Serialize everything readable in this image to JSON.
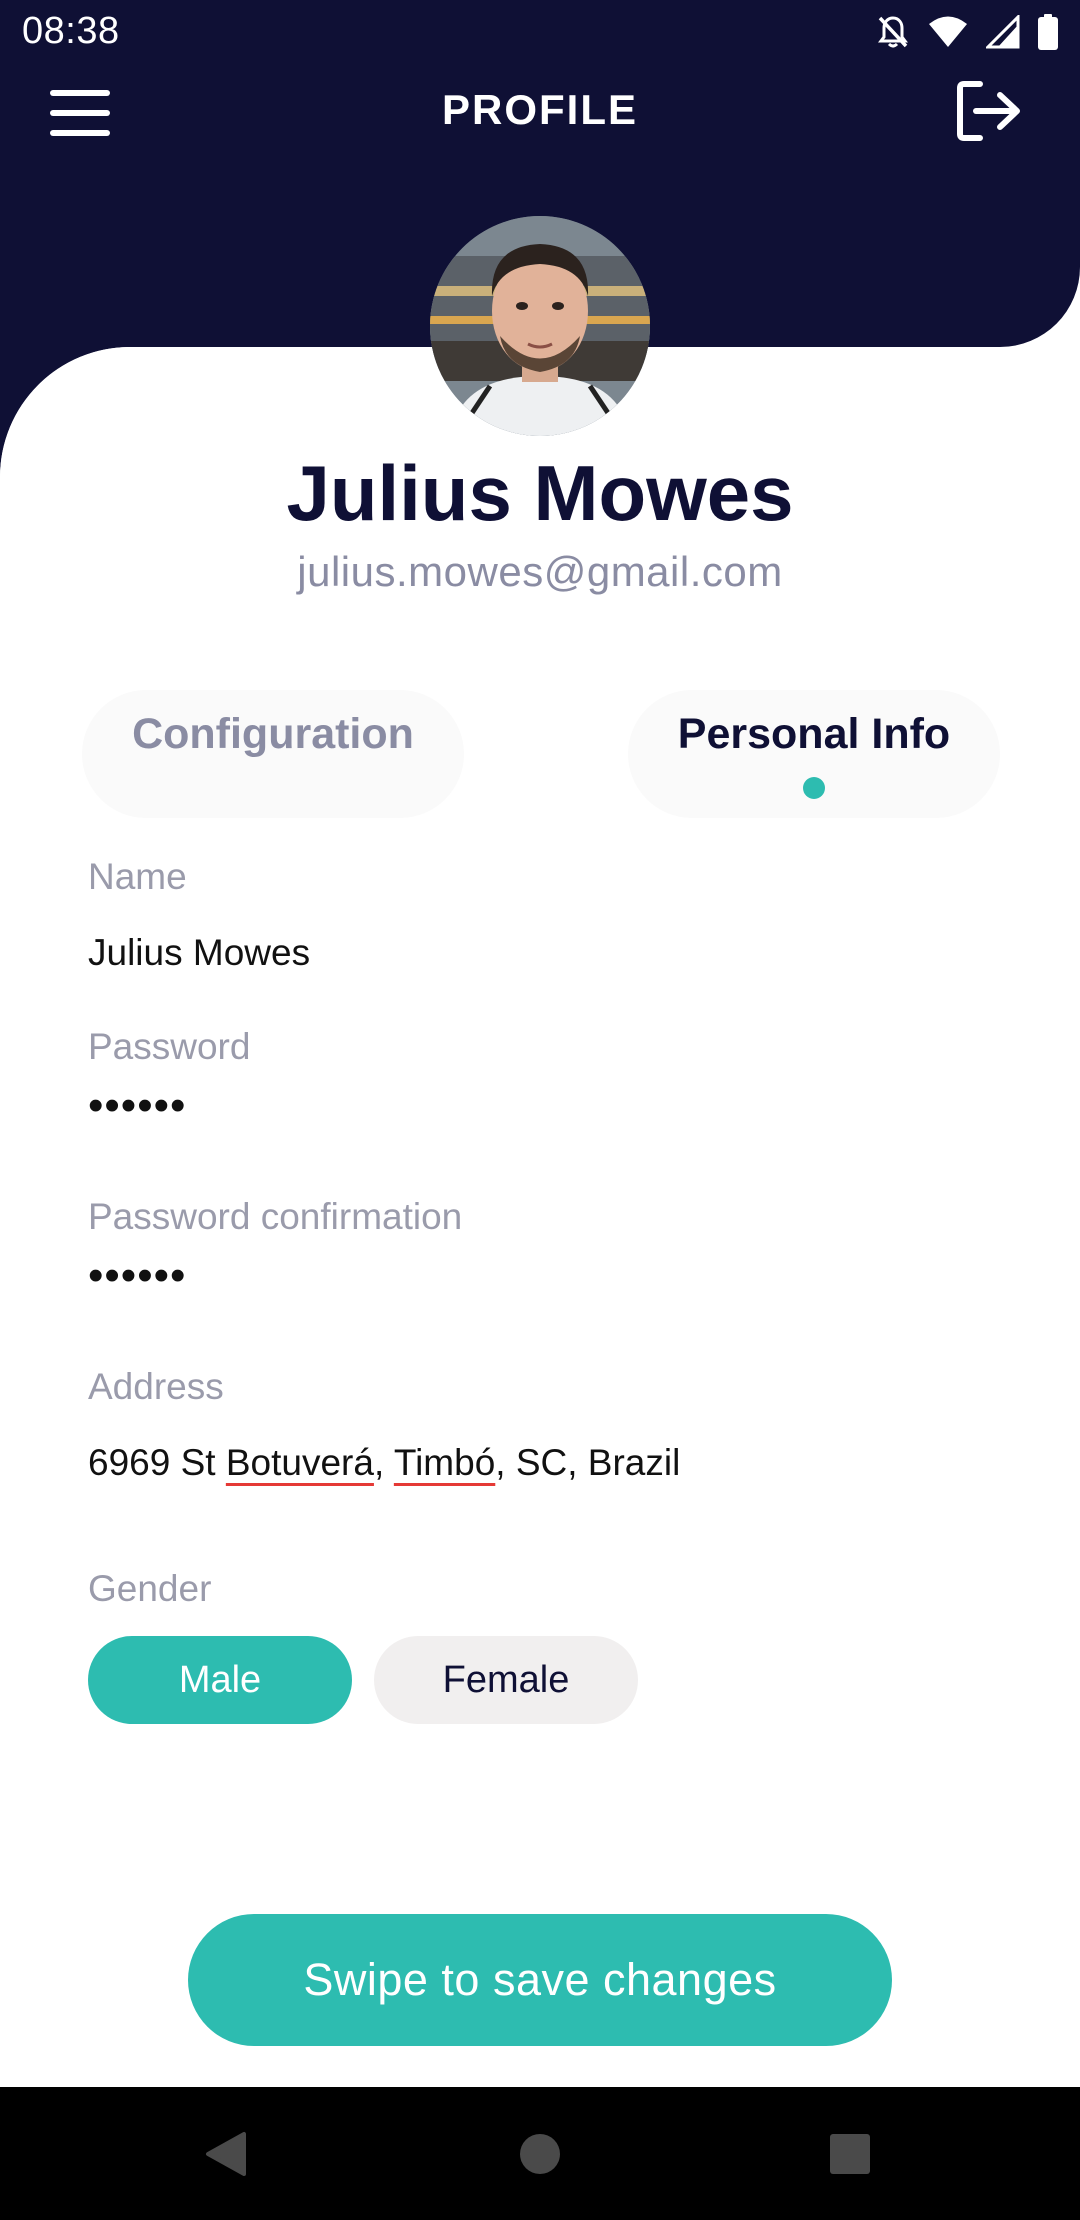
{
  "status_bar": {
    "time": "08:38",
    "icons": [
      "notifications-off-icon",
      "wifi-icon",
      "signal-icon",
      "battery-icon"
    ]
  },
  "header": {
    "title": "PROFILE",
    "menu_icon": "hamburger-menu-icon",
    "logout_icon": "logout-icon"
  },
  "profile": {
    "name": "Julius Mowes",
    "email": "julius.mowes@gmail.com"
  },
  "tabs": [
    {
      "label": "Configuration",
      "active": false
    },
    {
      "label": "Personal Info",
      "active": true
    }
  ],
  "form": {
    "name": {
      "label": "Name",
      "value": "Julius Mowes"
    },
    "password": {
      "label": "Password",
      "value": "••••••"
    },
    "password_confirmation": {
      "label": "Password confirmation",
      "value": "••••••"
    },
    "address": {
      "label": "Address",
      "parts": [
        "6969 St ",
        "Botuverá",
        ", ",
        "Timbó",
        ", SC, Brazil"
      ]
    },
    "gender": {
      "label": "Gender",
      "options": [
        "Male",
        "Female"
      ],
      "selected": "Male"
    }
  },
  "save_button": {
    "label": "Swipe to save changes"
  },
  "nav_bar": {
    "icons": [
      "back-icon",
      "home-icon",
      "recents-icon"
    ]
  },
  "colors": {
    "navy": "#0f1035",
    "accent": "#2dbcb0",
    "muted_text": "#8a8ca3",
    "pill_inactive": "#f1efef"
  }
}
